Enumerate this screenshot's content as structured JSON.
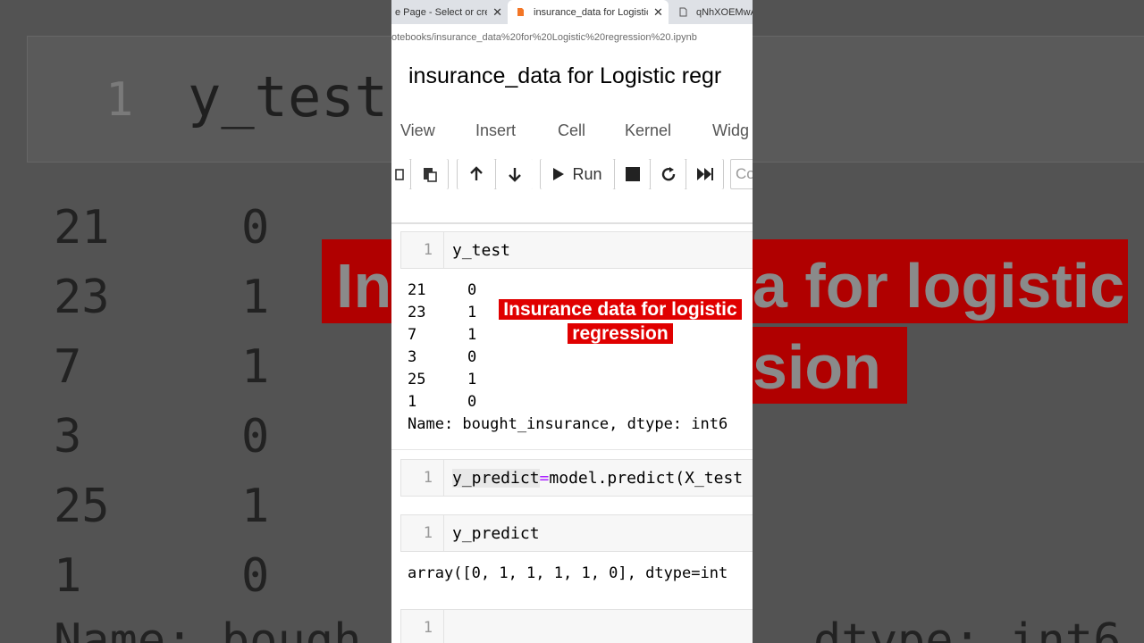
{
  "browser": {
    "tabs": [
      {
        "label": "e Page - Select or create",
        "active": false
      },
      {
        "label": "insurance_data for Logistic re",
        "active": true
      },
      {
        "label": "qNhXOEMwAA",
        "active": false
      }
    ],
    "url": "otebooks/insurance_data%20for%20Logistic%20regression%20.ipynb"
  },
  "notebook": {
    "title": "insurance_data for Logistic regr",
    "menu": [
      "View",
      "Insert",
      "Cell",
      "Kernel",
      "Widg"
    ],
    "toolbar": {
      "run_label": "Run",
      "cell_type_partial": "Co"
    }
  },
  "cells": [
    {
      "line": "1",
      "code": "y_test"
    },
    {
      "line": "1",
      "code_var": "y_predict",
      "code_op": "=",
      "code_rest": "model.predict(X_test"
    },
    {
      "line": "1",
      "code": "y_predict"
    },
    {
      "line": "1",
      "code": ""
    }
  ],
  "output_y_test": {
    "rows": [
      {
        "index": "21",
        "value": "0"
      },
      {
        "index": "23",
        "value": "1"
      },
      {
        "index": "7",
        "value": "1"
      },
      {
        "index": "3",
        "value": "0"
      },
      {
        "index": "25",
        "value": "1"
      },
      {
        "index": "1",
        "value": "0"
      }
    ],
    "footer": "Name: bought_insurance, dtype: int6"
  },
  "output_y_predict": "array([0, 1, 1, 1, 1, 0], dtype=int",
  "overlay": {
    "line1": "Insurance data for logistic",
    "line2": "regression"
  },
  "background": {
    "line_number": "1",
    "code": "y_test",
    "rows": [
      {
        "index": "21",
        "value": "0"
      },
      {
        "index": "23",
        "value": "1"
      },
      {
        "index": "7",
        "value": "1"
      },
      {
        "index": "3",
        "value": "0"
      },
      {
        "index": "25",
        "value": "1"
      },
      {
        "index": "1",
        "value": "0"
      }
    ],
    "footer_left": "Name: bough",
    "footer_right": "dtype: int6",
    "banner_left": "In",
    "banner_right_1": "a for logistic",
    "banner_right_2": "sion"
  },
  "colors": {
    "banner_red": "#e00000",
    "bg_gray": "#535353"
  }
}
